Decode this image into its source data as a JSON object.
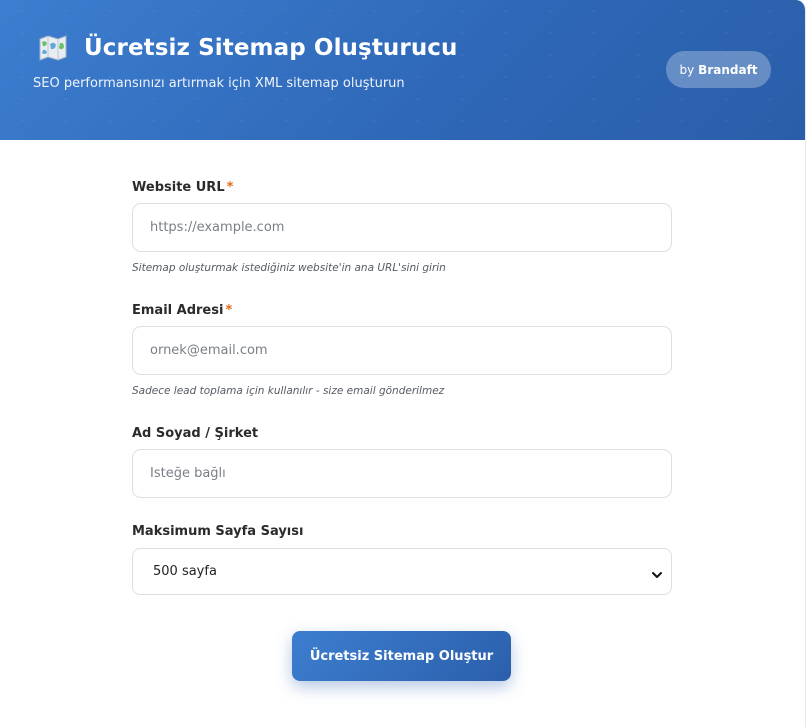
{
  "header": {
    "title": "Ücretsiz Sitemap Oluşturucu",
    "subtitle": "SEO performansınızı artırmak için XML sitemap oluşturun",
    "badge_prefix": "by",
    "badge_brand": "Brandaft",
    "icon": "map-icon"
  },
  "form": {
    "website_url": {
      "label": "Website URL",
      "required_mark": "*",
      "placeholder": "https://example.com",
      "value": "",
      "hint": "Sitemap oluşturmak istediğiniz website'in ana URL'sini girin"
    },
    "email": {
      "label": "Email Adresi",
      "required_mark": "*",
      "placeholder": "ornek@email.com",
      "value": "",
      "hint": "Sadece lead toplama için kullanılır - size email gönderilmez"
    },
    "name_company": {
      "label": "Ad Soyad / Şirket",
      "placeholder": "İsteğe bağlı",
      "value": ""
    },
    "max_pages": {
      "label": "Maksimum Sayfa Sayısı",
      "selected": "500 sayfa",
      "icon": "chevron-down-icon"
    },
    "submit_label": "Ücretsiz Sitemap Oluştur"
  },
  "colors": {
    "header_start": "#3d7ed0",
    "header_end": "#2a5ea9",
    "required": "#e06a1b",
    "button": "#3068b8"
  }
}
